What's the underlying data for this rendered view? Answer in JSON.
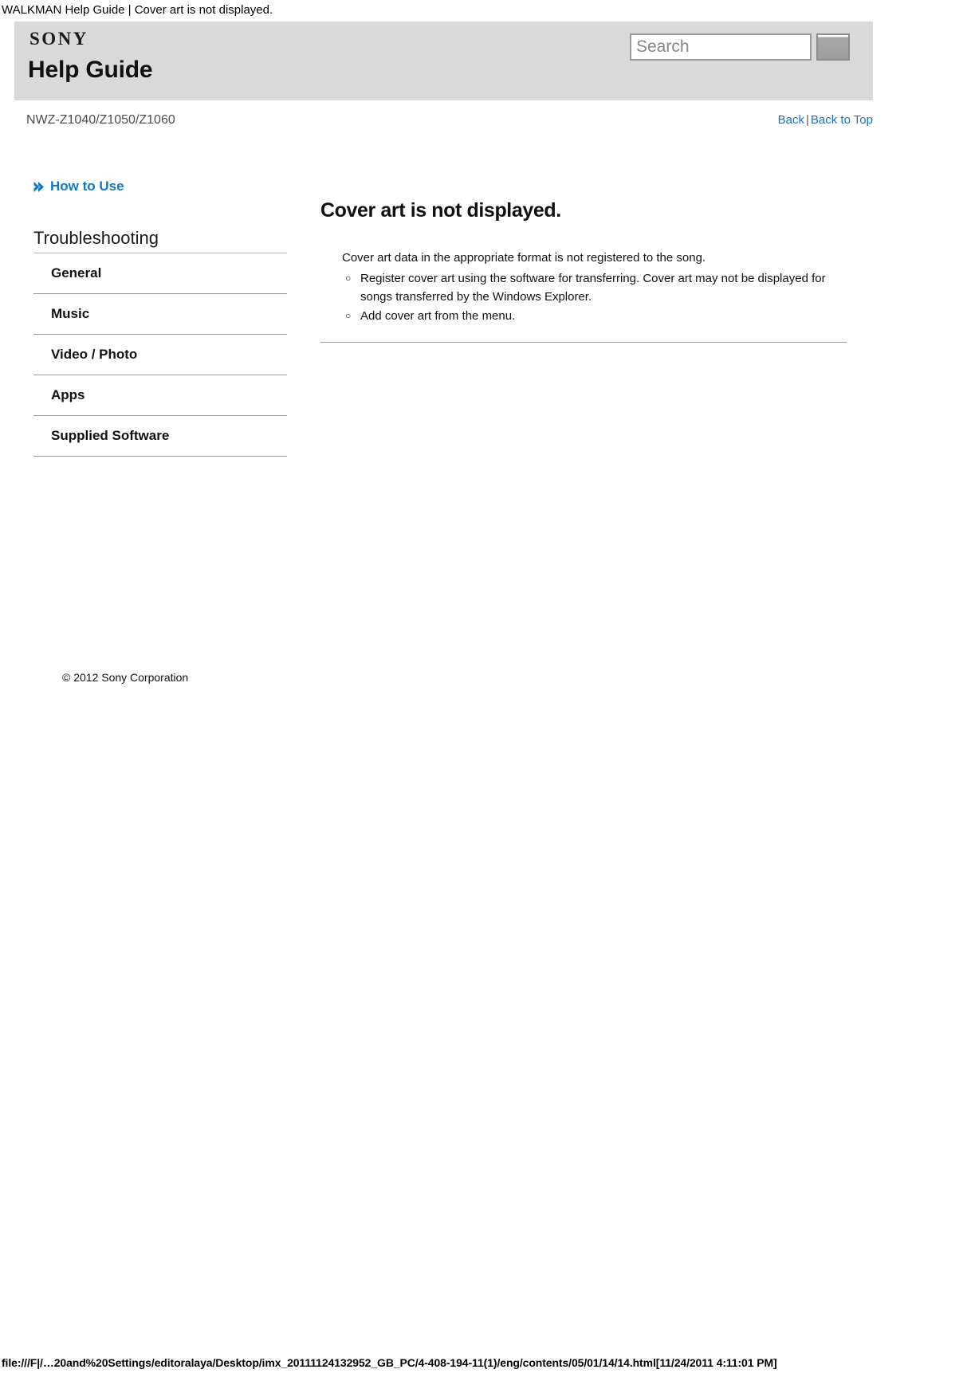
{
  "browser": {
    "page_title": "WALKMAN Help Guide | Cover art is not displayed.",
    "status_url": "file:///F|/…20and%20Settings/editoralaya/Desktop/imx_20111124132952_GB_PC/4-408-194-11(1)/eng/contents/05/01/14/14.html[11/24/2011 4:11:01 PM]"
  },
  "header": {
    "brand": "SONY",
    "title": "Help Guide",
    "search": {
      "value": "",
      "placeholder": "Search",
      "button_label": ""
    }
  },
  "model_row": {
    "model": "NWZ-Z1040/Z1050/Z1060",
    "back_link": "Back",
    "separator": "|",
    "back_to_top_link": "Back to Top"
  },
  "sidebar": {
    "how_to_use": "How to Use",
    "section_heading": "Troubleshooting",
    "items": [
      {
        "label": "General"
      },
      {
        "label": "Music"
      },
      {
        "label": "Video / Photo"
      },
      {
        "label": "Apps"
      },
      {
        "label": "Supplied Software"
      }
    ],
    "copyright": "© 2012 Sony Corporation"
  },
  "content": {
    "title": "Cover art is not displayed.",
    "lead": "Cover art data in the appropriate format is not registered to the song.",
    "bullets": [
      {
        "glyph": "○",
        "text": "Register cover art using the software for transferring. Cover art may not be displayed for songs transferred by the Windows Explorer."
      },
      {
        "glyph": "○",
        "text": "Add cover art from the menu."
      }
    ]
  },
  "colors": {
    "header_background": "#d9d9d9",
    "link_blue": "#1f6fc4",
    "howto_blue": "#1477c4",
    "rule_gray": "#9b9b9b",
    "text_black": "#111111"
  }
}
